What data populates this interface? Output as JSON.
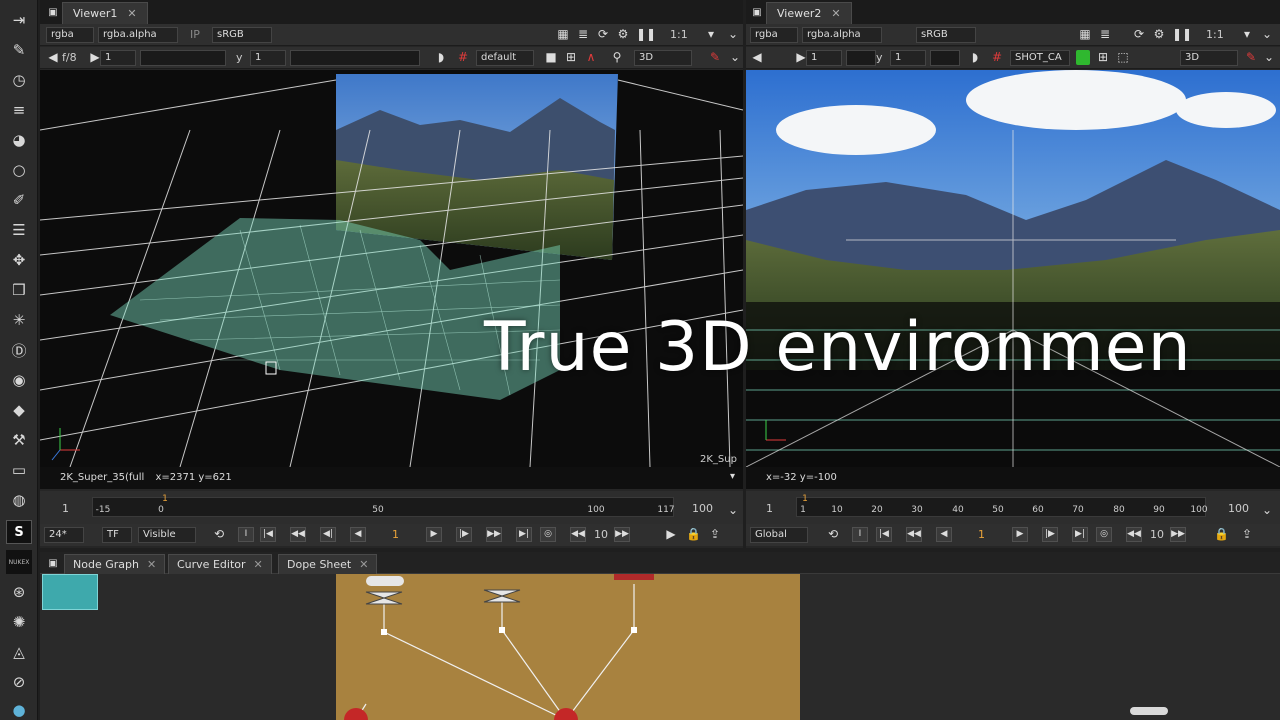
{
  "viewer1": {
    "tab": "Viewer1",
    "channels": "rgba",
    "alpha": "rgba.alpha",
    "ip": "IP",
    "colorspace": "sRGB",
    "zoom": "1:1",
    "fstop": "f/8",
    "frame_field": "1",
    "y_label": "y",
    "y_field": "1",
    "camera": "default",
    "view_mode": "3D",
    "status": "2K_Super_35(full",
    "coords": "x=2371 y=621",
    "format_corner": "2K_Sup",
    "in_frame": "1",
    "out_frame": "100",
    "ruler_ticks": [
      "-15",
      "0",
      "50",
      "100",
      "117"
    ],
    "playhead_label": "1",
    "fps": "24*",
    "tf": "TF",
    "visible": "Visible",
    "current_frame": "1",
    "step": "10"
  },
  "viewer2": {
    "tab": "Viewer2",
    "channels": "rgba",
    "alpha": "rgba.alpha",
    "colorspace": "sRGB",
    "zoom": "1:1",
    "frame_field": "1",
    "y_label": "y",
    "y_field": "1",
    "camera": "SHOT_CA",
    "view_mode": "3D",
    "coords": "x=-32 y=-100",
    "in_frame": "1",
    "out_frame": "100",
    "ruler_ticks": [
      "1",
      "10",
      "20",
      "30",
      "40",
      "50",
      "60",
      "70",
      "80",
      "90",
      "100"
    ],
    "playhead_label": "1",
    "global": "Global",
    "current_frame": "1",
    "step": "10"
  },
  "nodegraph": {
    "tabs": [
      "Node Graph",
      "Curve Editor",
      "Dope Sheet"
    ]
  },
  "overlay": {
    "caption": "True 3D environmen"
  },
  "toolbar": {
    "icons": [
      "viewer-icon",
      "paint-icon",
      "time-icon",
      "channel-icon",
      "color-icon",
      "filter-icon",
      "draw-icon",
      "merge-icon",
      "transform-icon",
      "3d-icon",
      "particle-icon",
      "deep-icon",
      "views-icon",
      "metadata-icon",
      "tools-icon",
      "other-icon",
      "globe-icon",
      "s-badge",
      "plugin-icon",
      "other-plugin-icon",
      "other-tool-icon",
      "other-round-icon"
    ],
    "badge_s": "S",
    "badge_text": "NUKEX"
  },
  "colors": {
    "accent_orange": "#e8a23a",
    "backdrop": "#a8823f",
    "node_teal": "#3ea9ac",
    "red": "#e03b3b"
  }
}
